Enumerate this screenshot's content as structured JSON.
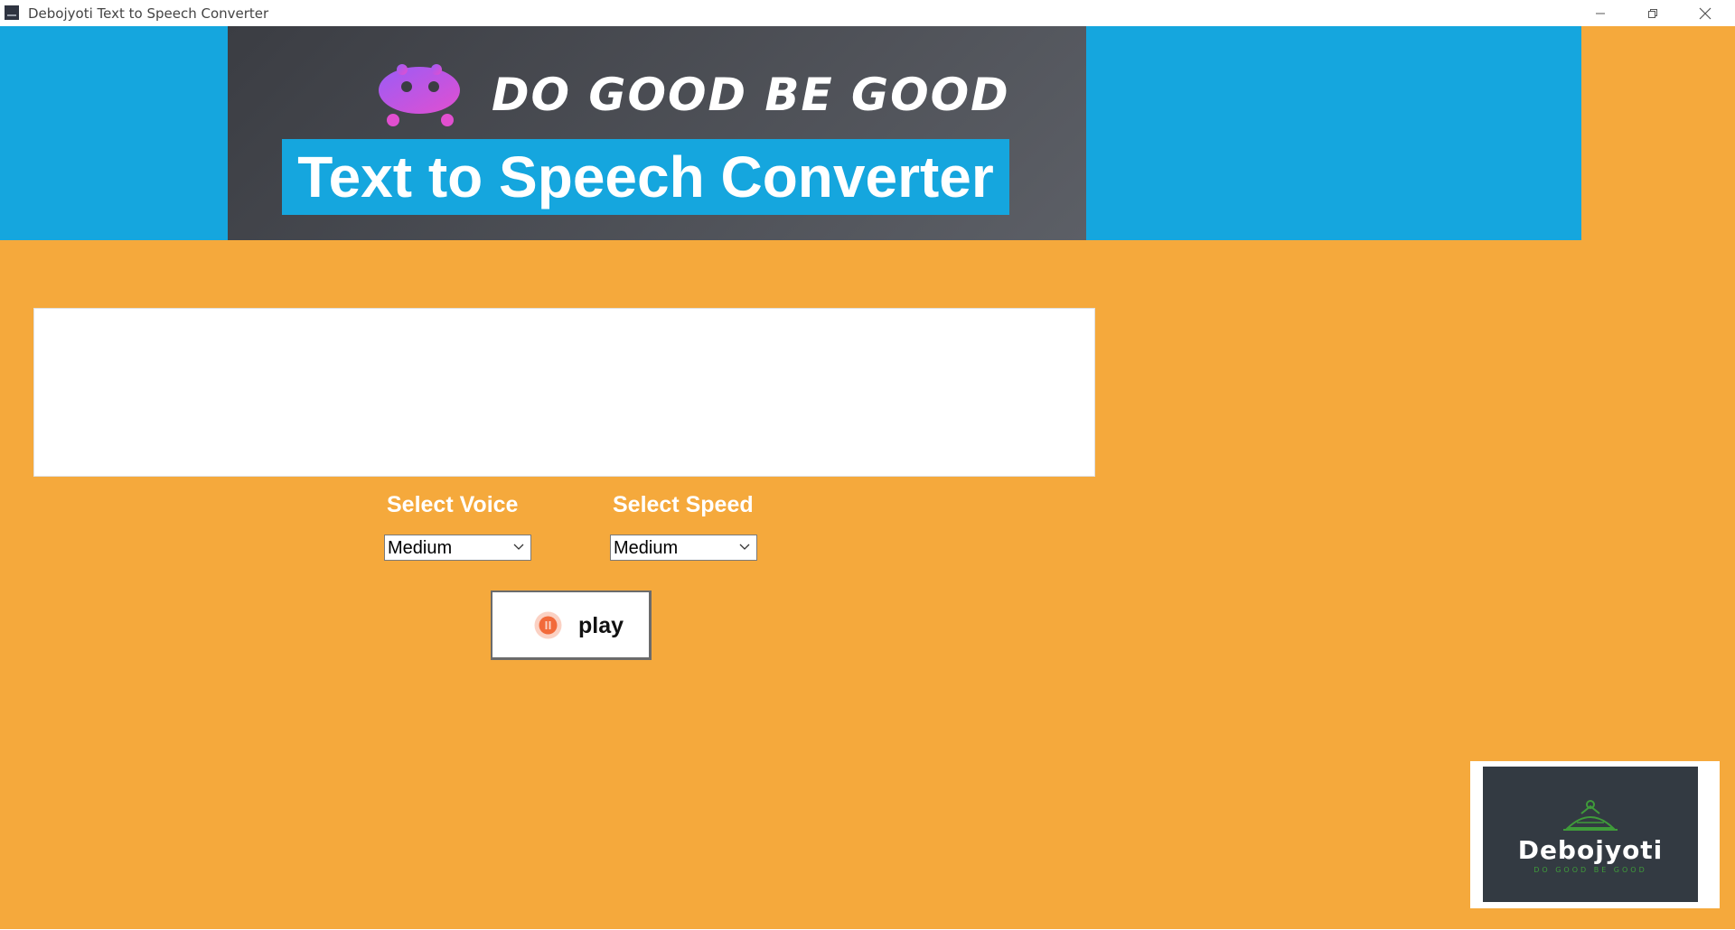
{
  "window": {
    "title": "Debojyoti Text to Speech Converter"
  },
  "banner": {
    "slogan": "DO GOOD BE GOOD",
    "headline": "Text to Speech Converter"
  },
  "text_input": {
    "value": ""
  },
  "voice": {
    "label": "Select Voice",
    "selected": "Medium"
  },
  "speed": {
    "label": "Select Speed",
    "selected": "Medium"
  },
  "play_button": {
    "label": "play"
  },
  "logo": {
    "name": "Debojyoti",
    "tagline": "DO GOOD BE GOOD"
  },
  "colors": {
    "background": "#f5a93c",
    "banner_blue": "#15a6de",
    "banner_dark": "#4a4d54",
    "logo_bg": "#333a42",
    "accent_green": "#3f9b3a"
  }
}
